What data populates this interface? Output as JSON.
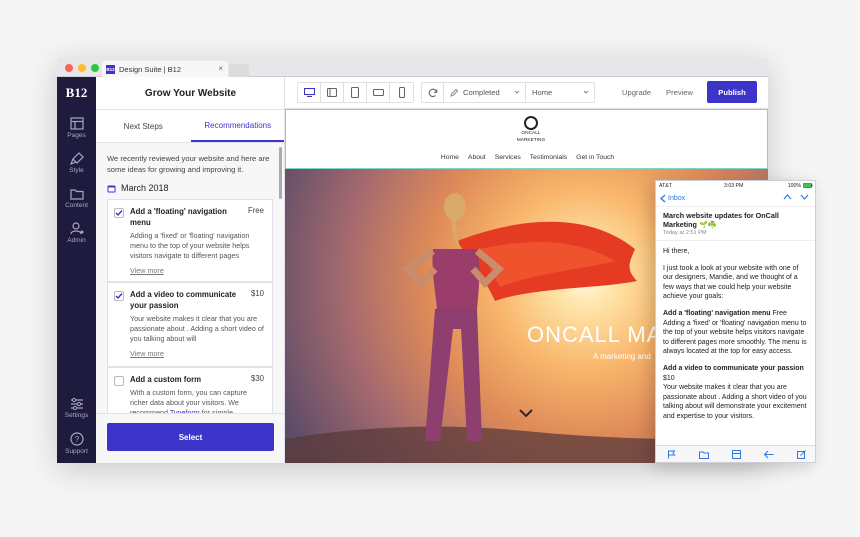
{
  "browser": {
    "tab_logo": "B12",
    "tab_title": "Design Suite | B12",
    "tab_close": "×"
  },
  "sidenav": {
    "logo": "B12",
    "items": [
      {
        "label": "Pages",
        "icon": "pages-icon"
      },
      {
        "label": "Style",
        "icon": "brush-icon"
      },
      {
        "label": "Content",
        "icon": "folder-icon"
      },
      {
        "label": "Admin",
        "icon": "user-gear-icon"
      }
    ],
    "bottom": [
      {
        "label": "Settings",
        "icon": "sliders-icon"
      },
      {
        "label": "Support",
        "icon": "question-icon"
      }
    ]
  },
  "panel": {
    "title": "Grow Your Website",
    "tabs": [
      "Next Steps",
      "Recommendations"
    ],
    "intro": "We recently reviewed your website and here are some ideas for growing and improving it.",
    "month": "March 2018",
    "cards": [
      {
        "title": "Add a 'floating' navigation menu",
        "price": "Free",
        "desc": "Adding a 'fixed' or 'floating' navigation menu to the top of your website helps visitors navigate to different pages",
        "more": "View more",
        "checked": true
      },
      {
        "title": "Add a video to communicate your passion",
        "price": "$10",
        "desc": "Your website makes it clear that you are passionate about . Adding a short video of you talking about will",
        "more": "View more",
        "checked": true
      },
      {
        "title": "Add a custom form",
        "price": "$30",
        "desc": "With a custom form, you can capture richer data about your visitors. We recommend",
        "link": "Typeform",
        "desc_tail": "for simple",
        "checked": false
      }
    ],
    "select_label": "Select"
  },
  "toolbar": {
    "status": "Completed",
    "page": "Home",
    "upgrade": "Upgrade",
    "preview": "Preview",
    "publish": "Publish"
  },
  "site": {
    "logo_line1": "ONCALL",
    "logo_line2": "MARKETING",
    "nav": [
      "Home",
      "About",
      "Services",
      "Testimonials",
      "Get in Touch"
    ],
    "hero_title": "ONCALL MA",
    "hero_sub": "A marketing and"
  },
  "phone": {
    "carrier": "AT&T",
    "time": "3:03 PM",
    "battery": "100%",
    "back": "Inbox",
    "subject": "March website updates for OnCall Marketing",
    "subject_emoji": "🌱☘️",
    "date": "Today at 2:51 PM",
    "greeting": "Hi there,",
    "para1": "I just took a look at your website with one of our designers, Mandie, and we thought of a few ways that we could help your website achieve your goals:",
    "item1_title": "Add a 'floating' navigation menu",
    "item1_price": "Free",
    "item1_desc": "Adding a 'fixed' or 'floating' navigation menu to the top of your website helps visitors navigate to different pages more smoothly. The menu is always located at the top for easy access.",
    "item2_title": "Add a video to communicate your passion",
    "item2_price": "$10",
    "item2_desc": "Your website makes it clear that you are passionate about . Adding a short video of you talking about will demonstrate your excitement and expertise to your visitors."
  },
  "colors": {
    "accent": "#3d35c9",
    "nav_bg": "#1f1b3f",
    "header_border": "#7fd6c7"
  }
}
